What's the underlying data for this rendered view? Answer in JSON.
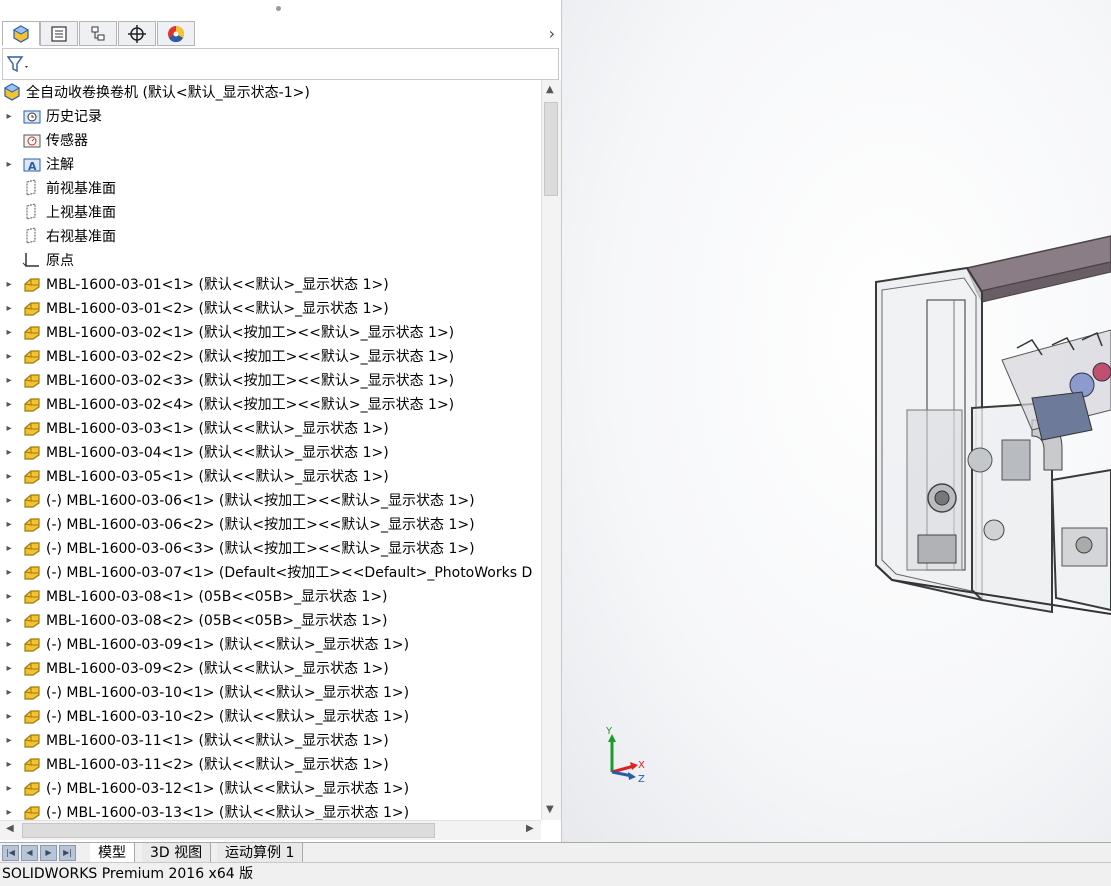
{
  "tree": {
    "root": "全自动收卷换卷机  (默认<默认_显示状态-1>)",
    "items": [
      {
        "label": "历史记录",
        "icon": "history-folder-icon",
        "expandable": true
      },
      {
        "label": "传感器",
        "icon": "sensor-folder-icon",
        "expandable": false
      },
      {
        "label": "注解",
        "icon": "annotation-folder-icon",
        "expandable": true
      },
      {
        "label": "前视基准面",
        "icon": "plane-icon",
        "expandable": false
      },
      {
        "label": "上视基准面",
        "icon": "plane-icon",
        "expandable": false
      },
      {
        "label": "右视基准面",
        "icon": "plane-icon",
        "expandable": false
      },
      {
        "label": "原点",
        "icon": "origin-icon",
        "expandable": false
      },
      {
        "label": "MBL-1600-03-01<1> (默认<<默认>_显示状态 1>)",
        "icon": "part-icon",
        "expandable": true
      },
      {
        "label": "MBL-1600-03-01<2> (默认<<默认>_显示状态 1>)",
        "icon": "part-icon",
        "expandable": true
      },
      {
        "label": "MBL-1600-03-02<1> (默认<按加工><<默认>_显示状态 1>)",
        "icon": "part-icon",
        "expandable": true
      },
      {
        "label": "MBL-1600-03-02<2> (默认<按加工><<默认>_显示状态 1>)",
        "icon": "part-icon",
        "expandable": true
      },
      {
        "label": "MBL-1600-03-02<3> (默认<按加工><<默认>_显示状态 1>)",
        "icon": "part-icon",
        "expandable": true
      },
      {
        "label": "MBL-1600-03-02<4> (默认<按加工><<默认>_显示状态 1>)",
        "icon": "part-icon",
        "expandable": true
      },
      {
        "label": "MBL-1600-03-03<1> (默认<<默认>_显示状态 1>)",
        "icon": "part-icon",
        "expandable": true
      },
      {
        "label": "MBL-1600-03-04<1> (默认<<默认>_显示状态 1>)",
        "icon": "part-icon",
        "expandable": true
      },
      {
        "label": "MBL-1600-03-05<1> (默认<<默认>_显示状态 1>)",
        "icon": "part-icon",
        "expandable": true
      },
      {
        "label": "(-) MBL-1600-03-06<1> (默认<按加工><<默认>_显示状态 1>)",
        "icon": "part-icon",
        "expandable": true
      },
      {
        "label": "(-) MBL-1600-03-06<2> (默认<按加工><<默认>_显示状态 1>)",
        "icon": "part-icon",
        "expandable": true
      },
      {
        "label": "(-) MBL-1600-03-06<3> (默认<按加工><<默认>_显示状态 1>)",
        "icon": "part-icon",
        "expandable": true
      },
      {
        "label": "(-) MBL-1600-03-07<1> (Default<按加工><<Default>_PhotoWorks D",
        "icon": "part-icon",
        "expandable": true
      },
      {
        "label": "MBL-1600-03-08<1> (05B<<05B>_显示状态 1>)",
        "icon": "part-icon",
        "expandable": true
      },
      {
        "label": "MBL-1600-03-08<2> (05B<<05B>_显示状态 1>)",
        "icon": "part-icon",
        "expandable": true
      },
      {
        "label": "(-) MBL-1600-03-09<1> (默认<<默认>_显示状态 1>)",
        "icon": "part-icon",
        "expandable": true
      },
      {
        "label": "MBL-1600-03-09<2> (默认<<默认>_显示状态 1>)",
        "icon": "part-icon",
        "expandable": true
      },
      {
        "label": "(-) MBL-1600-03-10<1> (默认<<默认>_显示状态 1>)",
        "icon": "part-icon",
        "expandable": true
      },
      {
        "label": "(-) MBL-1600-03-10<2> (默认<<默认>_显示状态 1>)",
        "icon": "part-icon",
        "expandable": true
      },
      {
        "label": "MBL-1600-03-11<1> (默认<<默认>_显示状态 1>)",
        "icon": "part-icon",
        "expandable": true
      },
      {
        "label": "MBL-1600-03-11<2> (默认<<默认>_显示状态 1>)",
        "icon": "part-icon",
        "expandable": true
      },
      {
        "label": "(-) MBL-1600-03-12<1> (默认<<默认>_显示状态 1>)",
        "icon": "part-icon",
        "expandable": true
      },
      {
        "label": "(-) MBL-1600-03-13<1> (默认<<默认>_显示状态 1>)",
        "icon": "part-icon",
        "expandable": true
      }
    ]
  },
  "panel_tabs": [
    {
      "name": "feature-manager-tab",
      "icon": "assembly-icon"
    },
    {
      "name": "property-manager-tab",
      "icon": "property-manager-icon"
    },
    {
      "name": "configuration-manager-tab",
      "icon": "configuration-icon"
    },
    {
      "name": "dimxpert-tab",
      "icon": "crosshair-icon"
    },
    {
      "name": "display-manager-tab",
      "icon": "color-wheel-icon"
    }
  ],
  "triad": {
    "y": "Y",
    "x": "X",
    "z": "Z"
  },
  "bottom_tabs": [
    "模型",
    "3D 视图",
    "运动算例 1"
  ],
  "status": "SOLIDWORKS Premium 2016 x64 版",
  "colors": {
    "part_icon": "#f2c230",
    "part_icon_edge": "#a07a10",
    "accent_blue": "#2a5ca8"
  }
}
